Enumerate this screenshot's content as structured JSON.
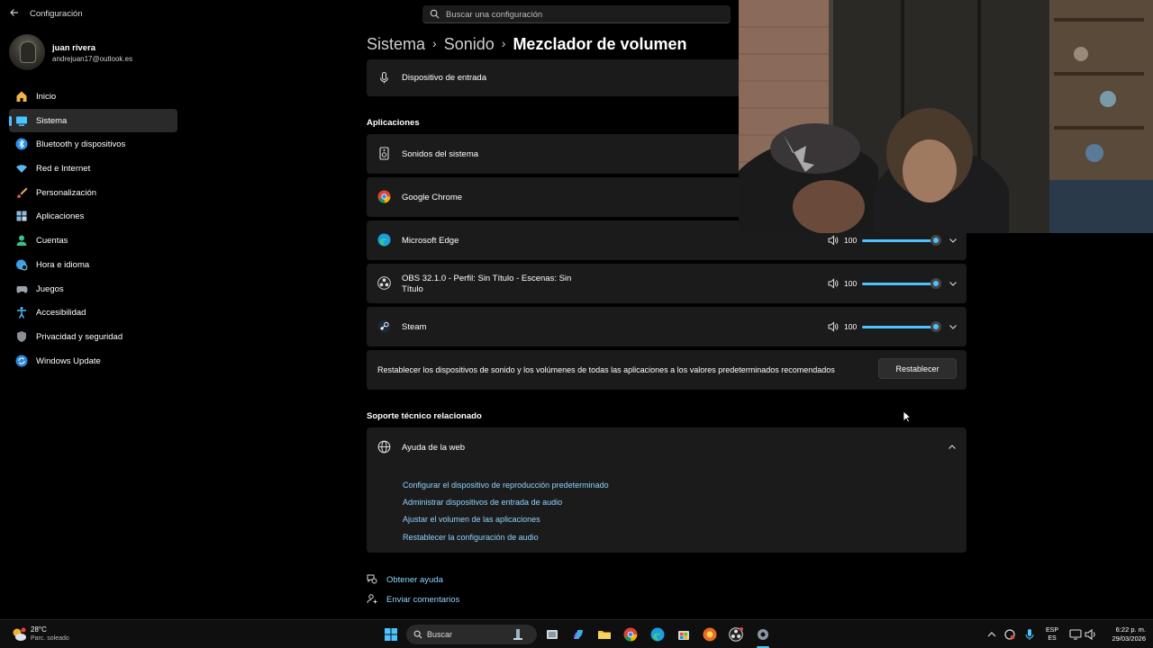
{
  "app": {
    "title": "Configuración"
  },
  "search": {
    "placeholder": "Buscar una configuración"
  },
  "user": {
    "name": "juan rivera",
    "email": "andrejuan17@outlook.es"
  },
  "sidebar": {
    "items": [
      {
        "label": "Inicio",
        "icon": "home-icon"
      },
      {
        "label": "Sistema",
        "icon": "system-icon",
        "active": true
      },
      {
        "label": "Bluetooth y dispositivos",
        "icon": "bluetooth-icon"
      },
      {
        "label": "Red e Internet",
        "icon": "wifi-icon"
      },
      {
        "label": "Personalización",
        "icon": "brush-icon"
      },
      {
        "label": "Aplicaciones",
        "icon": "apps-icon"
      },
      {
        "label": "Cuentas",
        "icon": "person-icon"
      },
      {
        "label": "Hora e idioma",
        "icon": "globe-clock-icon"
      },
      {
        "label": "Juegos",
        "icon": "gamepad-icon"
      },
      {
        "label": "Accesibilidad",
        "icon": "accessibility-icon"
      },
      {
        "label": "Privacidad y seguridad",
        "icon": "shield-icon"
      },
      {
        "label": "Windows Update",
        "icon": "update-icon"
      }
    ]
  },
  "breadcrumb": {
    "level1": "Sistema",
    "level2": "Sonido",
    "current": "Mezclador de volumen"
  },
  "input_device": {
    "label": "Dispositivo de entrada"
  },
  "apps_section": {
    "title": "Aplicaciones",
    "items": [
      {
        "name": "Sonidos del sistema",
        "icon": "speaker-box-icon"
      },
      {
        "name": "Google Chrome",
        "icon": "chrome-icon"
      },
      {
        "name": "Microsoft Edge",
        "icon": "edge-icon",
        "volume": "100"
      },
      {
        "name": "OBS 32.1.0 - Perfil: Sin Título - Escenas: Sin Título",
        "icon": "obs-icon",
        "volume": "100"
      },
      {
        "name": "Steam",
        "icon": "steam-icon",
        "volume": "100"
      }
    ]
  },
  "reset": {
    "text": "Restablecer los dispositivos de sonido y los volúmenes de todas las aplicaciones a los valores predeterminados recomendados",
    "button": "Restablecer"
  },
  "support": {
    "title": "Soporte técnico relacionado",
    "help_title": "Ayuda de la web",
    "links": [
      "Configurar el dispositivo de reproducción predeterminado",
      "Administrar dispositivos de entrada de audio",
      "Ajustar el volumen de las aplicaciones",
      "Restablecer la configuración de audio"
    ]
  },
  "footer": {
    "get_help": "Obtener ayuda",
    "feedback": "Enviar comentarios"
  },
  "taskbar": {
    "weather_temp": "28°C",
    "weather_desc": "Parc. soleado",
    "search_label": "Buscar",
    "lang_top": "ESP",
    "lang_bottom": "ES",
    "time": "6:22 p. m.",
    "date": "29/03/2026"
  },
  "colors": {
    "accent": "#4cc2ff",
    "link": "#8fd3ff",
    "card": "#1b1b1b",
    "background": "#000000"
  }
}
